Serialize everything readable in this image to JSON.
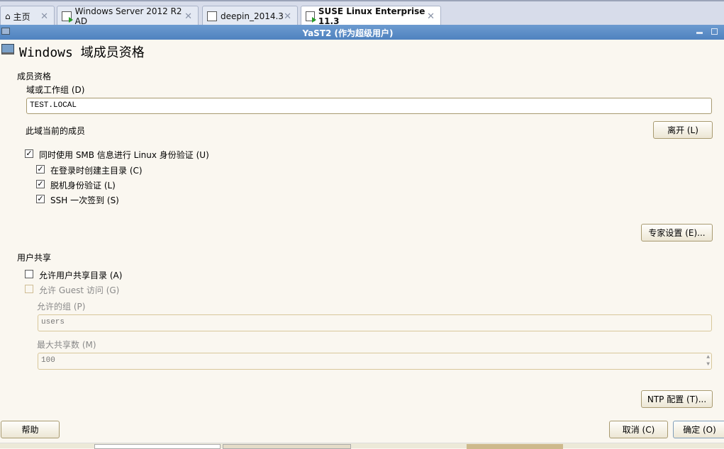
{
  "tabs": [
    {
      "label": "主页",
      "icon": "home-icon"
    },
    {
      "label": "Windows Server 2012 R2 AD",
      "icon": "vm-running-icon"
    },
    {
      "label": "deepin_2014.3",
      "icon": "vm-icon"
    },
    {
      "label": "SUSE Linux Enterprise 11.3",
      "icon": "vm-running-icon",
      "active": true
    }
  ],
  "window": {
    "title": "YaST2 (作为超级用户)"
  },
  "page": {
    "title": "Windows 域成员资格"
  },
  "membership": {
    "section": "成员资格",
    "domain_label": "域或工作组 (D)",
    "domain_value": "TEST.LOCAL",
    "status": "此域当前的成员",
    "leave_button": "离开 (L)",
    "options": [
      {
        "label": "同时使用 SMB 信息进行 Linux 身份验证 (U)",
        "checked": true
      },
      {
        "label": "在登录时创建主目录 (C)",
        "checked": true
      },
      {
        "label": "脱机身份验证 (L)",
        "checked": true
      },
      {
        "label": "SSH 一次签到 (S)",
        "checked": true
      }
    ],
    "expert_button": "专家设置 (E)..."
  },
  "sharing": {
    "section": "用户共享",
    "allow_share": {
      "label": "允许用户共享目录 (A)",
      "checked": false
    },
    "allow_guest": {
      "label": "允许 Guest 访问 (G)",
      "checked": false,
      "disabled": true
    },
    "group_label": "允许的组 (P)",
    "group_value": "users",
    "max_label": "最大共享数 (M)",
    "max_value": "100"
  },
  "ntp_button": "NTP 配置 (T)...",
  "footer": {
    "help": "帮助",
    "cancel": "取消 (C)",
    "ok": "确定 (O)"
  }
}
